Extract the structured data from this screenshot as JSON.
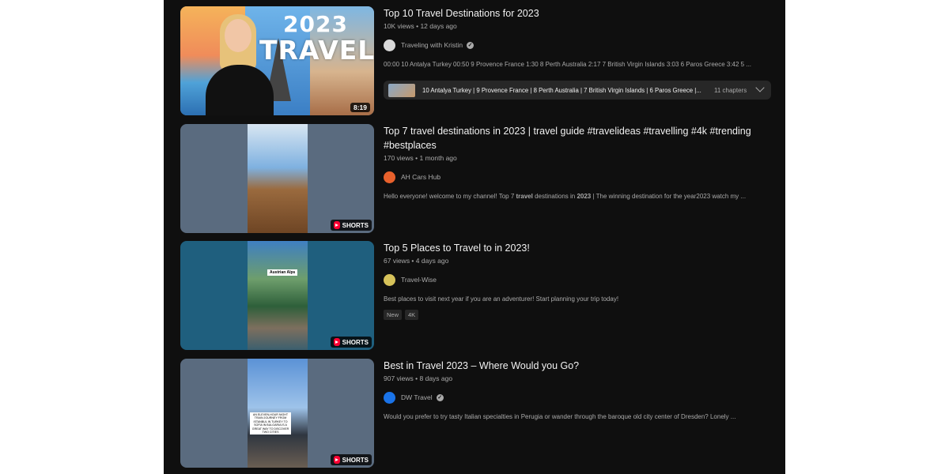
{
  "colors": {
    "background": "#0f0f0f",
    "text_primary": "#f1f1f1",
    "text_secondary": "#aaaaaa",
    "shorts_red": "#ff0033",
    "chip_bg": "#272727"
  },
  "results": [
    {
      "title": "Top 10 Travel Destinations for 2023",
      "meta": "10K views • 12 days ago",
      "channel": "Traveling with Kristin",
      "verified": true,
      "description": "00:00 10 Antalya Turkey 00:50 9 Provence France 1:30 8 Perth Australia 2:17 7 British Virgin Islands 3:03 6 Paros Greece 3:42 5 ...",
      "thumb_text_year": "2023",
      "thumb_text_word": "TRAVEL",
      "duration": "8:19",
      "chapters_text": "10 Antalya Turkey | 9 Provence France | 8 Perth Australia | 7 British Virgin Islands | 6 Paros Greece |...",
      "chapters_count": "11 chapters"
    },
    {
      "title": "Top 7 travel destinations in 2023 | travel guide #travelideas #travelling #4k #trending #bestplaces",
      "meta": "170 views • 1 month ago",
      "channel": "AH Cars Hub",
      "desc_pre": "Hello everyone! welcome to my channel! Top 7 ",
      "desc_b1": "travel",
      "desc_mid": " destinations in ",
      "desc_b2": "2023",
      "desc_post": " | The winning destination for the year2023 watch my ...",
      "shorts_label": "SHORTS"
    },
    {
      "title": "Top 5 Places to Travel to in 2023!",
      "meta": "67 views • 4 days ago",
      "channel": "Travel-Wise",
      "description": "Best places to visit next year if you are an adventurer! Start planning your trip today!",
      "badges": [
        "New",
        "4K"
      ],
      "thumb_label": "Austrian Alps",
      "shorts_label": "SHORTS"
    },
    {
      "title": "Best in Travel 2023 – Where Would you Go?",
      "meta": "907 views • 8 days ago",
      "channel": "DW Travel",
      "verified": true,
      "description": "Would you prefer to try tasty Italian specialties in Perugia or wander through the baroque old city center of Dresden? Lonely ...",
      "thumb_label": "AN ELEVEN-HOUR NIGHT TRAIN JOURNEY FROM ISTANBUL IN TURKEY TO SOFIA IN BULGARIA IS A GREAT WAY TO DISCOVER TWO CITIES",
      "shorts_label": "SHORTS"
    }
  ]
}
